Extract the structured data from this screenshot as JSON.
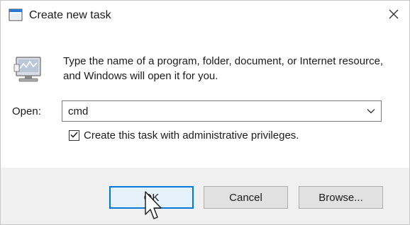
{
  "window": {
    "title": "Create new task",
    "app_icon": "run-dialog-icon",
    "close_icon": "close-icon"
  },
  "body": {
    "icon": "run-program-icon",
    "description": "Type the name of a program, folder, document, or Internet resource, and Windows will open it for you.",
    "open_label": "Open:",
    "open_value": "cmd",
    "dropdown_icon": "chevron-down-icon",
    "admin_checkbox_label": "Create this task with administrative privileges.",
    "admin_checked": true
  },
  "buttons": {
    "ok": "OK",
    "cancel": "Cancel",
    "browse": "Browse..."
  },
  "colors": {
    "accent": "#0078d7",
    "footer_bg": "#f0f0f0",
    "button_bg": "#e1e1e1"
  }
}
